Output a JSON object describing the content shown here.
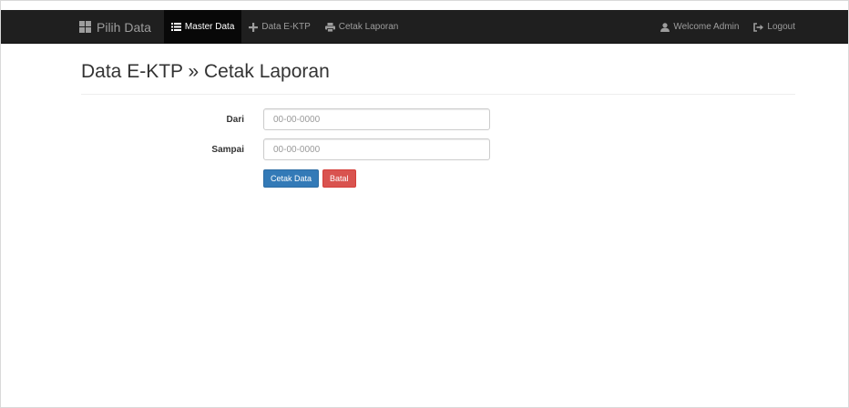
{
  "navbar": {
    "brand": {
      "label": "Pilih Data",
      "icon": "grid-icon"
    },
    "items": [
      {
        "label": "Master Data",
        "icon": "list-icon",
        "active": true
      },
      {
        "label": "Data E-KTP",
        "icon": "plus-icon",
        "active": false
      },
      {
        "label": "Cetak Laporan",
        "icon": "print-icon",
        "active": false
      }
    ],
    "right_items": [
      {
        "label": "Welcome Admin",
        "icon": "user-icon"
      },
      {
        "label": "Logout",
        "icon": "logout-icon"
      }
    ]
  },
  "page": {
    "title": "Data E-KTP » Cetak Laporan"
  },
  "form": {
    "dari": {
      "label": "Dari",
      "placeholder": "00-00-0000",
      "value": ""
    },
    "sampai": {
      "label": "Sampai",
      "placeholder": "00-00-0000",
      "value": ""
    },
    "cetak_label": "Cetak Data",
    "batal_label": "Batal"
  },
  "colors": {
    "navbar_bg": "#1f1f1f",
    "primary": "#337ab7",
    "danger": "#d9534f"
  }
}
